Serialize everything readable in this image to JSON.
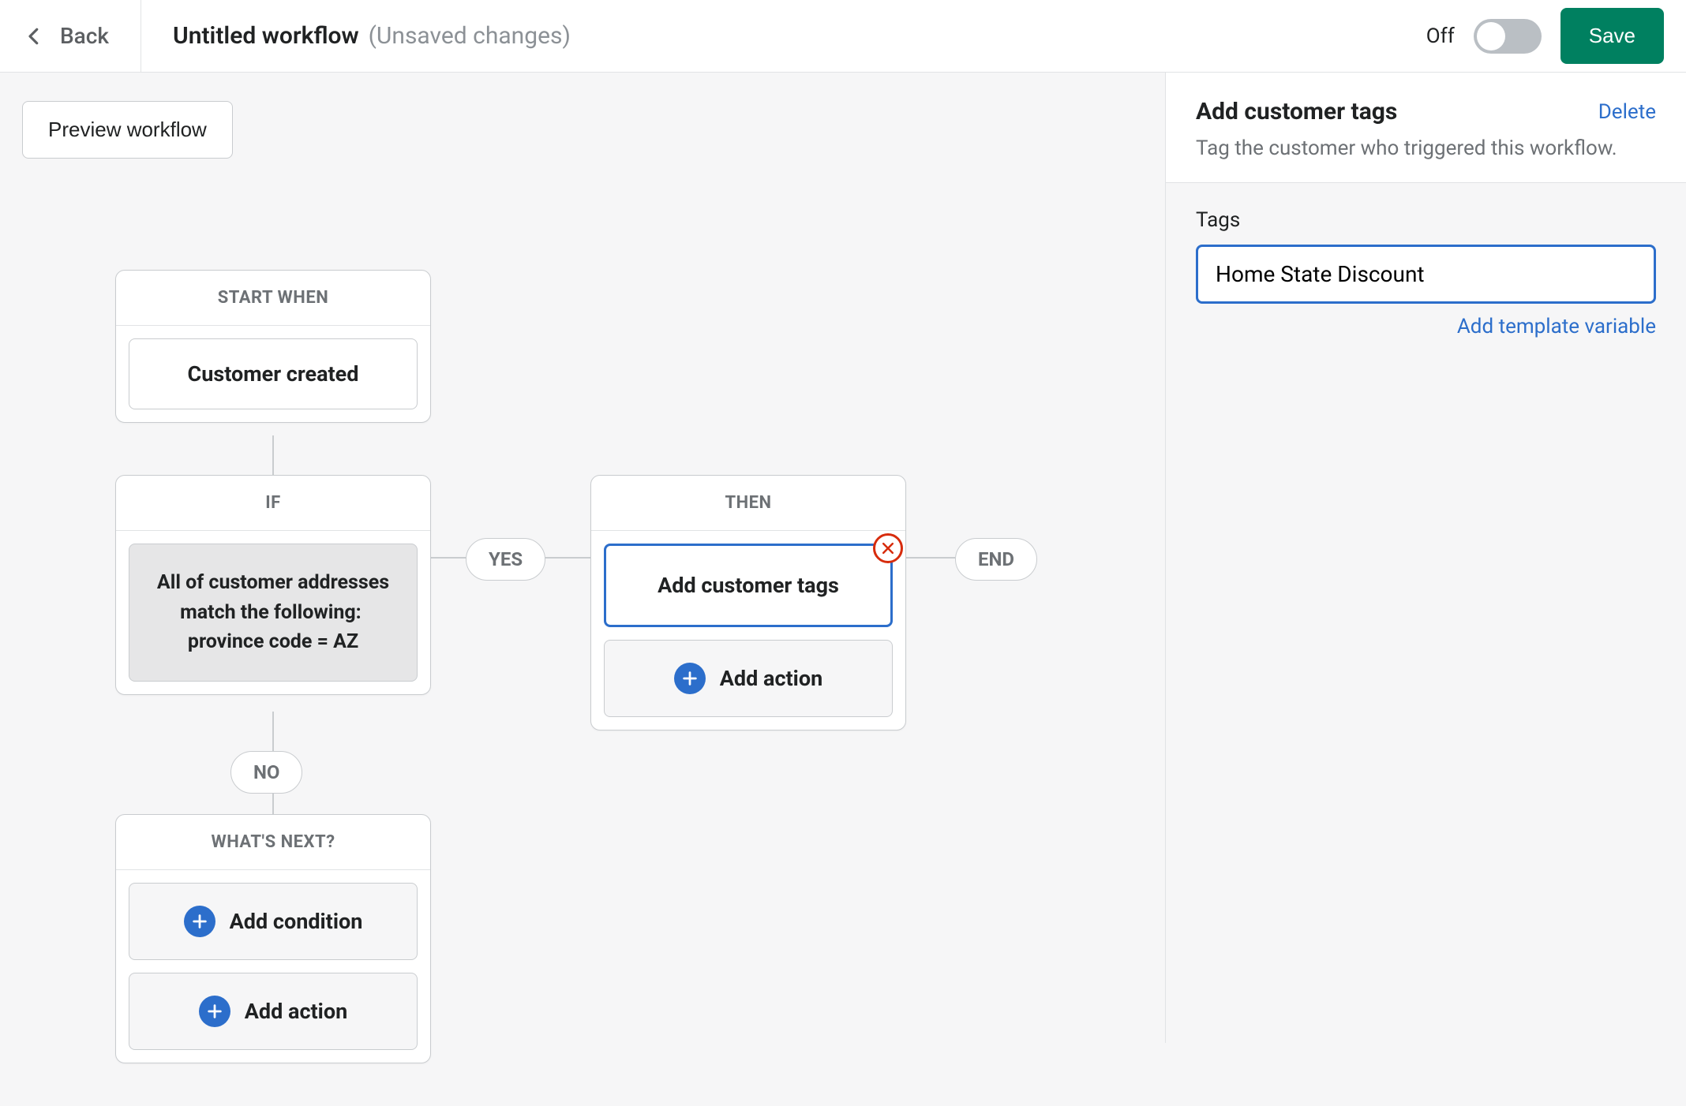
{
  "header": {
    "back_label": "Back",
    "title": "Untitled workflow",
    "unsaved_label": "(Unsaved changes)",
    "toggle_off_label": "Off",
    "save_label": "Save"
  },
  "canvas": {
    "preview_label": "Preview workflow",
    "trigger_header": "START WHEN",
    "trigger_label": "Customer created",
    "if_header": "IF",
    "if_condition": "All of customer addresses match the following:  province code = AZ",
    "yes_label": "YES",
    "no_label": "NO",
    "end_label": "END",
    "then_header": "THEN",
    "then_action_label": "Add customer tags",
    "add_action_label": "Add action",
    "next_header": "WHAT'S NEXT?",
    "add_condition_label": "Add condition"
  },
  "sidebar": {
    "title": "Add customer tags",
    "delete_label": "Delete",
    "subtitle": "Tag the customer who triggered this workflow.",
    "tags_label": "Tags",
    "tags_value": "Home State Discount",
    "template_link": "Add template variable"
  }
}
